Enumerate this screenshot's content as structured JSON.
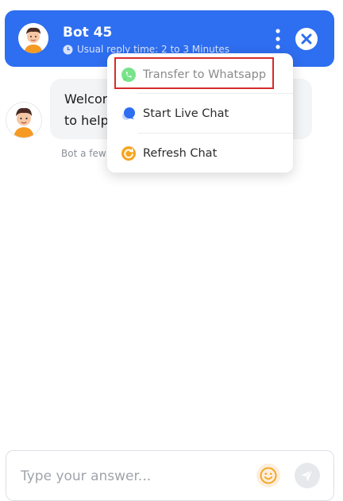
{
  "header": {
    "title": "Bot 45",
    "subtitle": "Usual reply time: 2 to 3 Minutes",
    "avatar_icon": "cartoon-boy-avatar",
    "menu_icon": "kebab-menu-icon",
    "close_icon": "close-icon",
    "accent_color": "#2e6ef0"
  },
  "message": {
    "text": "Welcome! How can I help you?",
    "visible_lines": [
      "Welcor",
      "to help"
    ],
    "meta": "Bot a few"
  },
  "menu": {
    "items": [
      {
        "label": "Transfer to Whatsapp",
        "icon": "whatsapp-icon",
        "highlighted": true
      },
      {
        "label": "Start Live Chat",
        "icon": "chat-bubbles-icon"
      },
      {
        "label": "Refresh Chat",
        "icon": "refresh-icon"
      }
    ]
  },
  "composer": {
    "placeholder": "Type your answer...",
    "emoji_icon": "smiley-icon",
    "send_icon": "send-icon"
  }
}
